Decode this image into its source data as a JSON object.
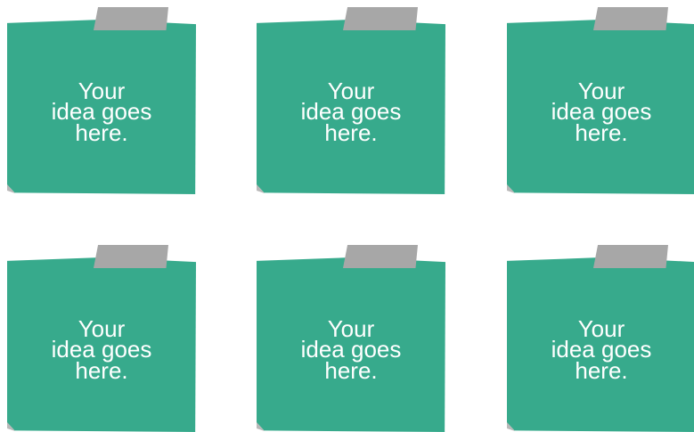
{
  "notes": [
    {
      "text": "Your\nidea goes\nhere."
    },
    {
      "text": "Your\nidea goes\nhere."
    },
    {
      "text": "Your\nidea goes\nhere."
    },
    {
      "text": "Your\nidea goes\nhere."
    },
    {
      "text": "Your\nidea goes\nhere."
    },
    {
      "text": "Your\nidea goes\nhere."
    }
  ],
  "colors": {
    "note": "#37aa8c",
    "tape": "#a7a7a7",
    "fold": "#b9b9b9",
    "text": "#ffffff"
  }
}
